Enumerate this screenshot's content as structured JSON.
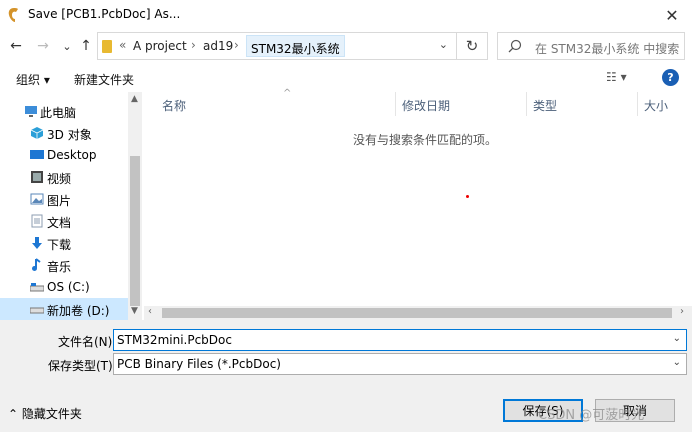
{
  "window": {
    "title": "Save [PCB1.PcbDoc] As...",
    "close_glyph": "✕"
  },
  "nav": {
    "back": "←",
    "forward": "→",
    "recent": "⌄",
    "up": "↑",
    "address": {
      "overflow": "«",
      "crumbs": [
        "A project",
        "ad19"
      ],
      "separator": "›",
      "current": "STM32最小系统",
      "dropdown": "⌄"
    },
    "refresh": "↻",
    "search_placeholder": "在 STM32最小系统 中搜索"
  },
  "toolbar": {
    "organize": "组织 ▾",
    "new_folder": "新建文件夹",
    "view": "☷ ▾",
    "help": "?"
  },
  "sidebar": {
    "items": [
      {
        "label": "此电脑",
        "icon": "computer-icon",
        "color": "#3c8dd9"
      },
      {
        "label": "3D 对象",
        "icon": "3d-objects-icon",
        "color": "#2b9fd8"
      },
      {
        "label": "Desktop",
        "icon": "desktop-icon",
        "color": "#1e77d3"
      },
      {
        "label": "视频",
        "icon": "video-icon",
        "color": "#444444"
      },
      {
        "label": "图片",
        "icon": "pictures-icon",
        "color": "#5a87b8"
      },
      {
        "label": "文档",
        "icon": "documents-icon",
        "color": "#8c9db2"
      },
      {
        "label": "下载",
        "icon": "downloads-icon",
        "color": "#1e77d3"
      },
      {
        "label": "音乐",
        "icon": "music-icon",
        "color": "#1e77d3"
      },
      {
        "label": "OS (C:)",
        "icon": "drive-c-icon",
        "color": "#777777"
      },
      {
        "label": "新加卷 (D:)",
        "icon": "drive-d-icon",
        "color": "#777777"
      }
    ]
  },
  "filelist": {
    "columns": [
      "名称",
      "修改日期",
      "类型",
      "大小"
    ],
    "empty_message": "没有与搜索条件匹配的项。"
  },
  "form": {
    "filename_label": "文件名(N):",
    "filename_value": "STM32mini.PcbDoc",
    "filetype_label": "保存类型(T):",
    "filetype_value": "PCB Binary Files (*.PcbDoc)",
    "hide_folders": "⌃ 隐藏文件夹",
    "save": "保存(S)",
    "cancel": "取消"
  },
  "watermark": "CSDN @可菠时光"
}
